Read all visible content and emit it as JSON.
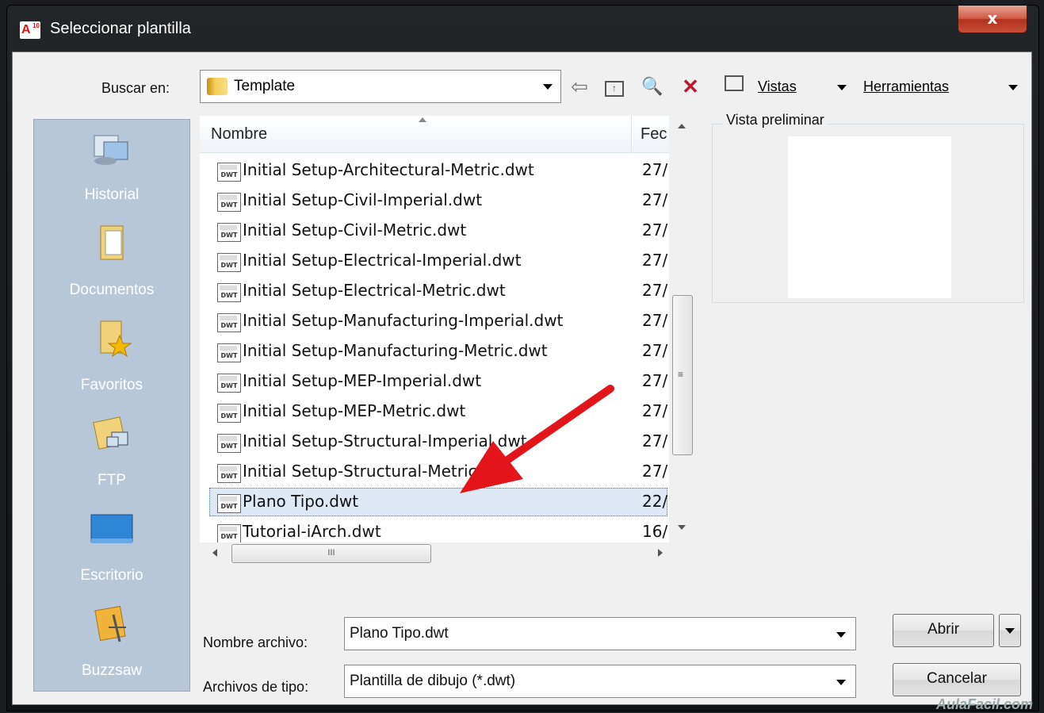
{
  "window": {
    "title": "Seleccionar plantilla",
    "app_icon_text": "A",
    "app_icon_version": "10",
    "close_label": "x"
  },
  "toolbar": {
    "lookin_label": "Buscar en:",
    "lookin_value": "Template",
    "back_glyph": "⇦",
    "views_label": "Vistas",
    "tools_label": "Herramientas"
  },
  "places": [
    {
      "label": "Historial",
      "icon": "history-icon"
    },
    {
      "label": "Documentos",
      "icon": "documents-icon"
    },
    {
      "label": "Favoritos",
      "icon": "favorites-icon"
    },
    {
      "label": "FTP",
      "icon": "ftp-icon"
    },
    {
      "label": "Escritorio",
      "icon": "desktop-icon"
    },
    {
      "label": "Buzzsaw",
      "icon": "buzzsaw-icon"
    }
  ],
  "file_list": {
    "col_name": "Nombre",
    "col_date": "Fec",
    "file_icon_text": "DWT",
    "rows": [
      {
        "name": "Initial Setup-Architectural-Metric.dwt",
        "date": "27/"
      },
      {
        "name": "Initial Setup-Civil-Imperial.dwt",
        "date": "27/"
      },
      {
        "name": "Initial Setup-Civil-Metric.dwt",
        "date": "27/"
      },
      {
        "name": "Initial Setup-Electrical-Imperial.dwt",
        "date": "27/"
      },
      {
        "name": "Initial Setup-Electrical-Metric.dwt",
        "date": "27/"
      },
      {
        "name": "Initial Setup-Manufacturing-Imperial.dwt",
        "date": "27/"
      },
      {
        "name": "Initial Setup-Manufacturing-Metric.dwt",
        "date": "27/"
      },
      {
        "name": "Initial Setup-MEP-Imperial.dwt",
        "date": "27/"
      },
      {
        "name": "Initial Setup-MEP-Metric.dwt",
        "date": "27/"
      },
      {
        "name": "Initial Setup-Structural-Imperial.dwt",
        "date": "27/"
      },
      {
        "name": "Initial Setup-Structural-Metric.dwt",
        "date": "27/"
      },
      {
        "name": "Plano Tipo.dwt",
        "date": "22/",
        "selected": true
      },
      {
        "name": "Tutorial-iArch.dwt",
        "date": "16/"
      }
    ]
  },
  "scrollbar_grip": "≡",
  "hscroll_grip": "III",
  "preview": {
    "label": "Vista preliminar"
  },
  "form": {
    "filename_label": "Nombre archivo:",
    "filename_value": "Plano Tipo.dwt",
    "filetype_label": "Archivos de tipo:",
    "filetype_value": "Plantilla de dibujo (*.dwt)"
  },
  "buttons": {
    "open": "Abrir",
    "cancel": "Cancelar"
  },
  "watermark": "AulaFacil.com",
  "colors": {
    "annotation_arrow": "#e3141a",
    "places_panel": "#b8c7d8",
    "selection": "#dfe9f6"
  }
}
